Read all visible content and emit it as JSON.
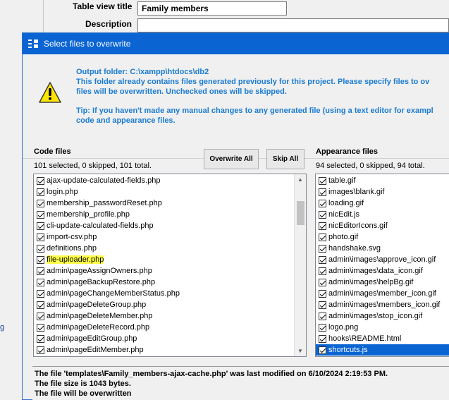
{
  "background": {
    "table_view_title_label": "Table view title",
    "table_view_title_value": "Family members",
    "description_label": "Description",
    "side_fragment": "g"
  },
  "dialog": {
    "title": "Select files to overwrite",
    "info": {
      "line1": "Output folder: C:\\xampp\\htdocs\\db2",
      "line2": "This folder already contains files generated previously for this project. Please specify files to ov",
      "line3": "files will be overwritten. Unchecked ones will be skipped.",
      "line4": "Tip: If you haven't made any manual changes to any generated file (using a text editor for exampl",
      "line5": "code and appearance files."
    },
    "code": {
      "label": "Code files",
      "count": "101 selected, 0 skipped, 101 total.",
      "overwrite_all": "Overwrite All",
      "skip_all": "Skip All",
      "files": [
        "ajax-update-calculated-fields.php",
        "login.php",
        "membership_passwordReset.php",
        "membership_profile.php",
        "cli-update-calculated-fields.php",
        "import-csv.php",
        "definitions.php",
        "file-uploader.php",
        "admin\\pageAssignOwners.php",
        "admin\\pageBackupRestore.php",
        "admin\\pageChangeMemberStatus.php",
        "admin\\pageDeleteGroup.php",
        "admin\\pageDeleteMember.php",
        "admin\\pageDeleteRecord.php",
        "admin\\pageEditGroup.php",
        "admin\\pageEditMember.php"
      ]
    },
    "appearance": {
      "label": "Appearance files",
      "count": "94 selected, 0 skipped, 94 total.",
      "files": [
        "table.gif",
        "images\\blank.gif",
        "loading.gif",
        "nicEdit.js",
        "nicEditorIcons.gif",
        "photo.gif",
        "handshake.svg",
        "admin\\images\\approve_icon.gif",
        "admin\\images\\data_icon.gif",
        "admin\\images\\helpBg.gif",
        "admin\\images\\member_icon.gif",
        "admin\\images\\members_icon.gif",
        "admin\\images\\stop_icon.gif",
        "logo.png",
        "hooks\\README.html",
        "shortcuts.js"
      ]
    },
    "status": {
      "line1": "The file 'templates\\Family_members-ajax-cache.php' was last modified on 6/10/2024 2:19:53 PM.",
      "line2": "The file size is 1043 bytes.",
      "line3": "The file will be overwritten"
    }
  },
  "colors": {
    "titlebar": "#0a64d2",
    "info_text": "#1a7bd0",
    "highlight": "#ffff4a",
    "selection": "#0a64d2"
  }
}
